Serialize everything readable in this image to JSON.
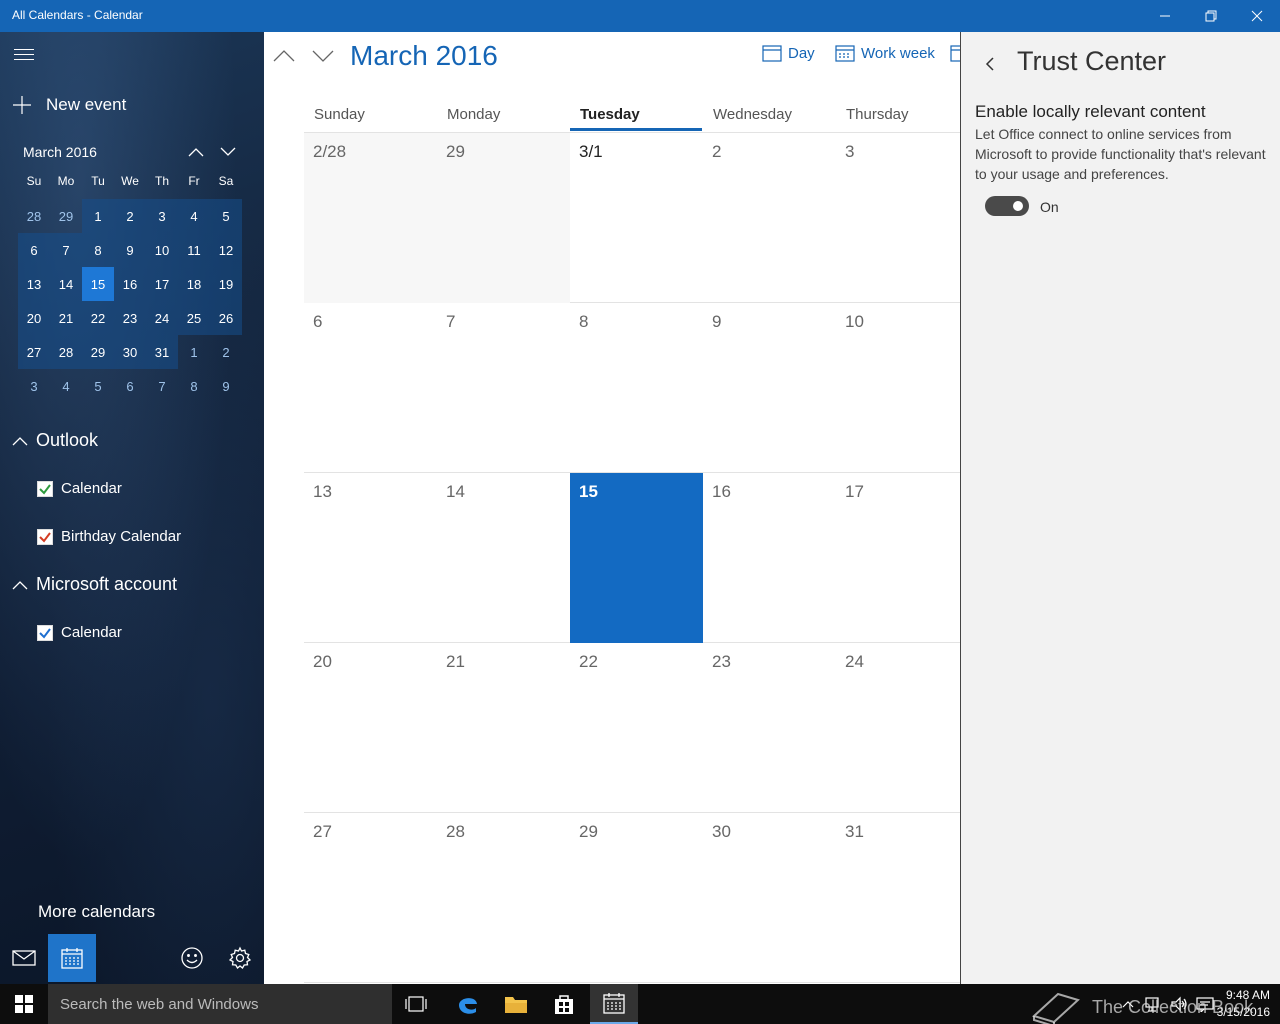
{
  "window": {
    "title": "All Calendars - Calendar"
  },
  "sidebar": {
    "new_event": "New event",
    "mini_month": "March 2016",
    "weekdays": [
      "Su",
      "Mo",
      "Tu",
      "We",
      "Th",
      "Fr",
      "Sa"
    ],
    "weeks": [
      [
        "28",
        "29",
        "1",
        "2",
        "3",
        "4",
        "5"
      ],
      [
        "6",
        "7",
        "8",
        "9",
        "10",
        "11",
        "12"
      ],
      [
        "13",
        "14",
        "15",
        "16",
        "17",
        "18",
        "19"
      ],
      [
        "20",
        "21",
        "22",
        "23",
        "24",
        "25",
        "26"
      ],
      [
        "27",
        "28",
        "29",
        "30",
        "31",
        "1",
        "2"
      ],
      [
        "3",
        "4",
        "5",
        "6",
        "7",
        "8",
        "9"
      ]
    ],
    "groups": [
      {
        "name": "Outlook",
        "calendars": [
          {
            "label": "Calendar",
            "color": "#2e9b3e"
          },
          {
            "label": "Birthday Calendar",
            "color": "#d43c23"
          }
        ]
      },
      {
        "name": "Microsoft account",
        "calendars": [
          {
            "label": "Calendar",
            "color": "#1e6fd0"
          }
        ]
      }
    ],
    "more_calendars": "More calendars"
  },
  "main": {
    "month_title": "March 2016",
    "views": [
      "Day",
      "Work week"
    ],
    "day_headers": [
      "Sunday",
      "Monday",
      "Tuesday",
      "Wednesday",
      "Thursday"
    ],
    "weeks": [
      [
        "2/28",
        "29",
        "3/1",
        "2",
        "3"
      ],
      [
        "6",
        "7",
        "8",
        "9",
        "10"
      ],
      [
        "13",
        "14",
        "15",
        "16",
        "17"
      ],
      [
        "20",
        "21",
        "22",
        "23",
        "24"
      ],
      [
        "27",
        "28",
        "29",
        "30",
        "31"
      ]
    ]
  },
  "trust_center": {
    "title": "Trust Center",
    "heading": "Enable locally relevant content",
    "description": "Let Office connect to online services from Microsoft to provide functionality that's relevant to your usage and preferences.",
    "toggle_state": "On"
  },
  "taskbar": {
    "search_placeholder": "Search the web and Windows",
    "time": "9:48 AM",
    "date": "3/15/2016",
    "watermark": "The Collection Book"
  },
  "colors": {
    "accent": "#1565b5",
    "today": "#136ac2"
  }
}
